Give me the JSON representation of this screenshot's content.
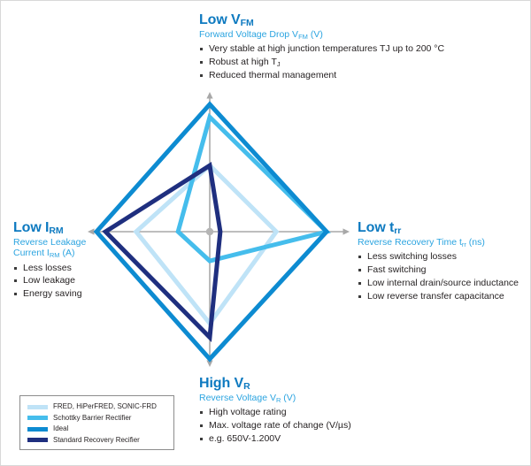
{
  "chart_data": {
    "type": "radar",
    "title": "Diode technology comparison radar",
    "axes": [
      {
        "key": "vfm",
        "label": "Low V_FM",
        "position": "top"
      },
      {
        "key": "trr",
        "label": "Low t_rr",
        "position": "right"
      },
      {
        "key": "vr",
        "label": "High V_R",
        "position": "bottom"
      },
      {
        "key": "irm",
        "label": "Low I_RM",
        "position": "left"
      }
    ],
    "categories": [
      "Low V_FM",
      "Low t_rr",
      "High V_R",
      "Low I_RM"
    ],
    "range": [
      0,
      100
    ],
    "grid": false,
    "legend_position": "bottom-left",
    "series": [
      {
        "name": "FRED, HiPerFRED, SONIC-FRD",
        "color": "#bfe3f7",
        "values": [
          52,
          57,
          72,
          65
        ]
      },
      {
        "name": "Schottky Barrier Rectifier",
        "color": "#45bdec",
        "values": [
          90,
          100,
          23,
          28
        ]
      },
      {
        "name": "Ideal",
        "color": "#0d8bd1",
        "values": [
          100,
          100,
          100,
          100
        ]
      },
      {
        "name": "Standard Recovery Recifier",
        "color": "#1f2f7f",
        "values": [
          52,
          9,
          83,
          92
        ]
      }
    ]
  },
  "axis_labels": {
    "top": {
      "title_main": "Low V",
      "title_sub": "FM",
      "sub_pre": "Forward Voltage Drop V",
      "sub_sub": "FM",
      "sub_post": " (V)",
      "bullets": [
        "Very stable at high junction temperatures TJ up to 200 °C",
        "Robust at high T",
        "Reduced thermal management"
      ],
      "bullet1_sub": "J"
    },
    "right": {
      "title_main": "Low t",
      "title_sub": "rr",
      "sub_pre": "Reverse Recovery Time t",
      "sub_sub": "rr",
      "sub_post": " (ns)",
      "bullets": [
        "Less switching losses",
        "Fast switching",
        "Low internal drain/source inductance",
        "Low reverse transfer capacitance"
      ]
    },
    "bottom": {
      "title_main": "High V",
      "title_sub": "R",
      "sub_pre": "Reverse Voltage V",
      "sub_sub": "R",
      "sub_post": " (V)",
      "bullets": [
        "High voltage rating",
        "Max. voltage rate of change (V/µs)",
        "e.g. 650V-1.200V"
      ]
    },
    "left": {
      "title_main": "Low I",
      "title_sub": "RM",
      "sub_line1_pre": "Reverse Leakage",
      "sub_line2_pre": "Current I",
      "sub_line2_sub": "RM",
      "sub_line2_post": " (A)",
      "bullets": [
        "Less losses",
        "Low leakage",
        "Energy saving"
      ]
    }
  },
  "legend": {
    "items": [
      {
        "label": "FRED, HiPerFRED, SONIC-FRD",
        "color": "#bfe3f7"
      },
      {
        "label": "Schottky Barrier Rectifier",
        "color": "#45bdec"
      },
      {
        "label": "Ideal",
        "color": "#0d8bd1"
      },
      {
        "label": "Standard Recovery Recifier",
        "color": "#1f2f7f"
      }
    ]
  },
  "colors": {
    "heading": "#0e7ac0",
    "subheading": "#2ba4e0",
    "body": "#231f20",
    "axis_line": "#a8a8a8"
  }
}
